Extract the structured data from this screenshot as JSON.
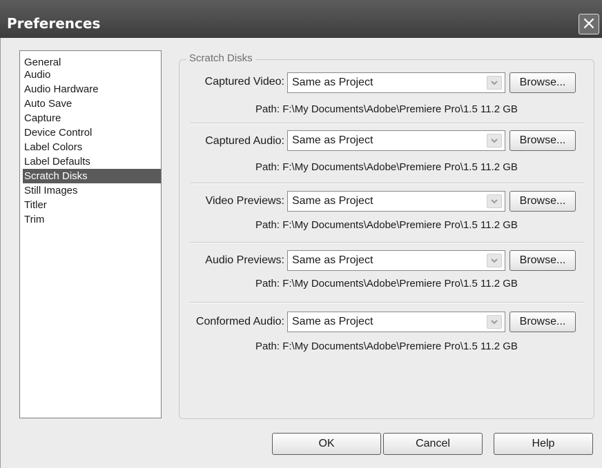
{
  "window": {
    "title": "Preferences"
  },
  "sidebar": {
    "items": [
      {
        "label": "General"
      },
      {
        "label": "Audio"
      },
      {
        "label": "Audio Hardware"
      },
      {
        "label": "Auto Save"
      },
      {
        "label": "Capture"
      },
      {
        "label": "Device Control"
      },
      {
        "label": "Label Colors"
      },
      {
        "label": "Label Defaults"
      },
      {
        "label": "Scratch Disks"
      },
      {
        "label": "Still Images"
      },
      {
        "label": "Titler"
      },
      {
        "label": "Trim"
      }
    ],
    "selected": "Scratch Disks"
  },
  "scratch": {
    "group_title": "Scratch Disks",
    "browse_label": "Browse...",
    "rows": [
      {
        "label": "Captured Video:",
        "value": "Same as Project",
        "path": "Path: F:\\My Documents\\Adobe\\Premiere Pro\\1.5   11.2 GB"
      },
      {
        "label": "Captured Audio:",
        "value": "Same as Project",
        "path": "Path: F:\\My Documents\\Adobe\\Premiere Pro\\1.5   11.2 GB"
      },
      {
        "label": "Video Previews:",
        "value": "Same as Project",
        "path": "Path: F:\\My Documents\\Adobe\\Premiere Pro\\1.5   11.2 GB"
      },
      {
        "label": "Audio Previews:",
        "value": "Same as Project",
        "path": "Path: F:\\My Documents\\Adobe\\Premiere Pro\\1.5   11.2 GB"
      },
      {
        "label": "Conformed Audio:",
        "value": "Same as Project",
        "path": "Path: F:\\My Documents\\Adobe\\Premiere Pro\\1.5   11.2 GB"
      }
    ]
  },
  "footer": {
    "ok": "OK",
    "cancel": "Cancel",
    "help": "Help"
  },
  "icons": {
    "close": "close-icon",
    "dropdown": "chevron-down-icon"
  }
}
